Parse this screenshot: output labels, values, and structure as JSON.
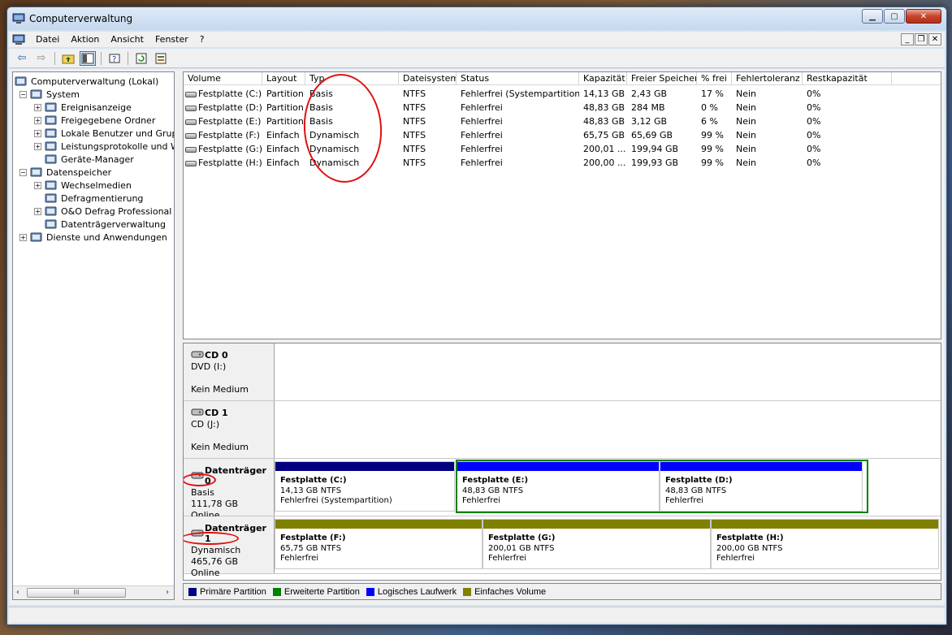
{
  "window": {
    "title": "Computerverwaltung"
  },
  "menu": [
    "Datei",
    "Aktion",
    "Ansicht",
    "Fenster",
    "?"
  ],
  "toolbar": {
    "back_icon": "arrow-left-icon",
    "forward_icon": "arrow-right-icon",
    "up_icon": "folder-up-icon",
    "tree_toggle_icon": "show-hide-tree-icon",
    "help_icon": "help-icon",
    "refresh_icon": "refresh-icon",
    "properties_icon": "properties-icon"
  },
  "tree": {
    "root": "Computerverwaltung (Lokal)",
    "items": [
      {
        "label": "Computerverwaltung (Lokal)",
        "level": 0,
        "expander": "",
        "icon": "computer-icon"
      },
      {
        "label": "System",
        "level": 1,
        "expander": "−",
        "icon": "system-tools-icon"
      },
      {
        "label": "Ereignisanzeige",
        "level": 2,
        "expander": "+",
        "icon": "event-viewer-icon"
      },
      {
        "label": "Freigegebene Ordner",
        "level": 2,
        "expander": "+",
        "icon": "shared-folder-icon"
      },
      {
        "label": "Lokale Benutzer und Grupp",
        "level": 2,
        "expander": "+",
        "icon": "users-icon"
      },
      {
        "label": "Leistungsprotokolle und W",
        "level": 2,
        "expander": "+",
        "icon": "performance-icon"
      },
      {
        "label": "Geräte-Manager",
        "level": 2,
        "expander": "",
        "icon": "device-manager-icon"
      },
      {
        "label": "Datenspeicher",
        "level": 1,
        "expander": "−",
        "icon": "storage-icon"
      },
      {
        "label": "Wechselmedien",
        "level": 2,
        "expander": "+",
        "icon": "removable-media-icon"
      },
      {
        "label": "Defragmentierung",
        "level": 2,
        "expander": "",
        "icon": "defrag-icon"
      },
      {
        "label": "O&O Defrag Professional E",
        "level": 2,
        "expander": "+",
        "icon": "oo-defrag-icon"
      },
      {
        "label": "Datenträgerverwaltung",
        "level": 2,
        "expander": "",
        "icon": "disk-management-icon"
      },
      {
        "label": "Dienste und Anwendungen",
        "level": 1,
        "expander": "+",
        "icon": "services-icon"
      }
    ],
    "scroll_thumb": "III"
  },
  "volume_table": {
    "columns": [
      "Volume",
      "Layout",
      "Typ",
      "Dateisystem",
      "Status",
      "Kapazität",
      "Freier Speicher",
      "% frei",
      "Fehlertoleranz",
      "Restkapazität"
    ],
    "rows": [
      [
        "Festplatte (C:)",
        "Partition",
        "Basis",
        "NTFS",
        "Fehlerfrei (Systempartition)",
        "14,13 GB",
        "2,43 GB",
        "17 %",
        "Nein",
        "0%"
      ],
      [
        "Festplatte (D:)",
        "Partition",
        "Basis",
        "NTFS",
        "Fehlerfrei",
        "48,83 GB",
        "284 MB",
        "0 %",
        "Nein",
        "0%"
      ],
      [
        "Festplatte (E:)",
        "Partition",
        "Basis",
        "NTFS",
        "Fehlerfrei",
        "48,83 GB",
        "3,12 GB",
        "6 %",
        "Nein",
        "0%"
      ],
      [
        "Festplatte (F:)",
        "Einfach",
        "Dynamisch",
        "NTFS",
        "Fehlerfrei",
        "65,75 GB",
        "65,69 GB",
        "99 %",
        "Nein",
        "0%"
      ],
      [
        "Festplatte (G:)",
        "Einfach",
        "Dynamisch",
        "NTFS",
        "Fehlerfrei",
        "200,01 ...",
        "199,94 GB",
        "99 %",
        "Nein",
        "0%"
      ],
      [
        "Festplatte (H:)",
        "Einfach",
        "Dynamisch",
        "NTFS",
        "Fehlerfrei",
        "200,00 ...",
        "199,93 GB",
        "99 %",
        "Nein",
        "0%"
      ]
    ]
  },
  "disks": [
    {
      "name": "CD 0",
      "line1": "DVD (I:)",
      "line2": "",
      "line3": "Kein Medium",
      "icon": "cd-drive-icon",
      "partitions": []
    },
    {
      "name": "CD 1",
      "line1": "CD (J:)",
      "line2": "",
      "line3": "Kein Medium",
      "icon": "cd-drive-icon",
      "partitions": []
    },
    {
      "name": "Datenträger 0",
      "line1": "Basis",
      "line2": "111,78 GB",
      "line3": "Online",
      "icon": "hard-disk-icon",
      "partitions": [
        {
          "name": "Festplatte  (C:)",
          "size": "14,13 GB NTFS",
          "status": "Fehlerfrei (Systempartition)",
          "kind": "primary"
        },
        {
          "name": "Festplatte  (E:)",
          "size": "48,83 GB NTFS",
          "status": "Fehlerfrei",
          "kind": "logical"
        },
        {
          "name": "Festplatte  (D:)",
          "size": "48,83 GB NTFS",
          "status": "Fehlerfrei",
          "kind": "logical"
        }
      ]
    },
    {
      "name": "Datenträger 1",
      "line1": "Dynamisch",
      "line2": "465,76 GB",
      "line3": "Online",
      "icon": "hard-disk-icon",
      "partitions": [
        {
          "name": "Festplatte  (F:)",
          "size": "65,75 GB NTFS",
          "status": "Fehlerfrei",
          "kind": "simple"
        },
        {
          "name": "Festplatte  (G:)",
          "size": "200,01 GB NTFS",
          "status": "Fehlerfrei",
          "kind": "simple"
        },
        {
          "name": "Festplatte  (H:)",
          "size": "200,00 GB NTFS",
          "status": "Fehlerfrei",
          "kind": "simple"
        }
      ]
    }
  ],
  "legend": [
    {
      "label": "Primäre Partition",
      "color": "#00007f"
    },
    {
      "label": "Erweiterte Partition",
      "color": "#008000"
    },
    {
      "label": "Logisches Laufwerk",
      "color": "#0000ff"
    },
    {
      "label": "Einfaches Volume",
      "color": "#808000"
    }
  ],
  "colors": {
    "primary": "#00007f",
    "logical": "#0000ff",
    "simple": "#808000",
    "extended": "#008000",
    "annotation": "#e01010"
  }
}
